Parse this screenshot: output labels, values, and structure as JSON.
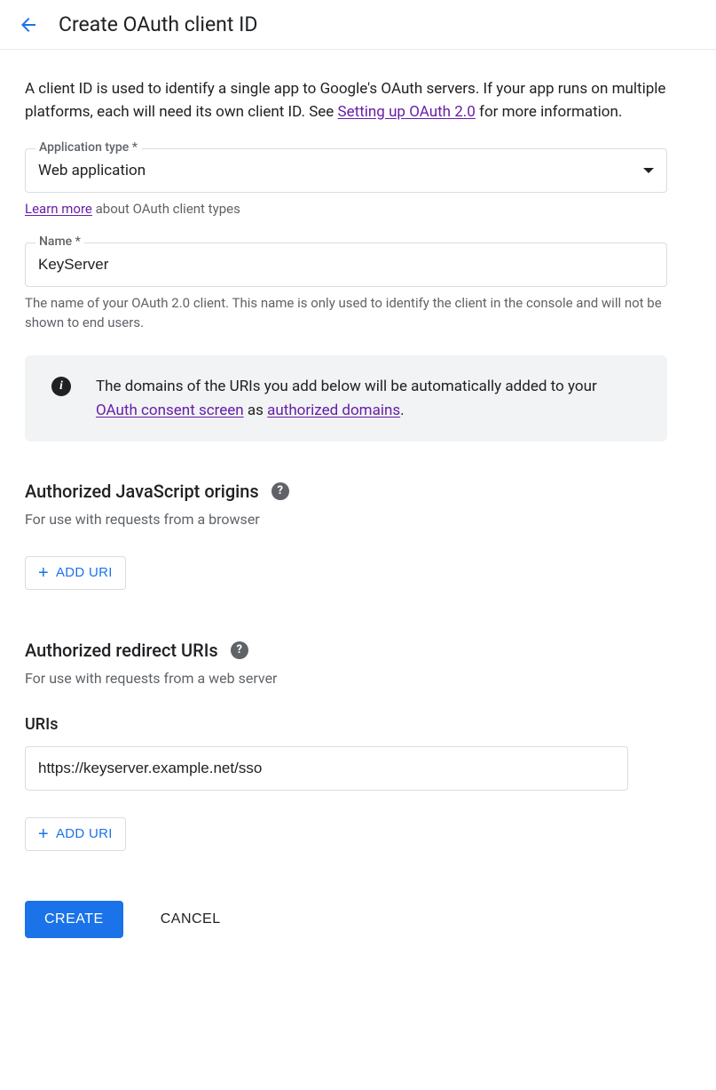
{
  "header": {
    "title": "Create OAuth client ID"
  },
  "intro": {
    "pre": "A client ID is used to identify a single app to Google's OAuth servers. If your app runs on multiple platforms, each will need its own client ID. See ",
    "link": "Setting up OAuth 2.0",
    "post": " for more information."
  },
  "app_type": {
    "label": "Application type *",
    "value": "Web application",
    "helper_link": "Learn more",
    "helper_text": " about OAuth client types"
  },
  "name_field": {
    "label": "Name *",
    "value": "KeyServer",
    "helper": "The name of your OAuth 2.0 client. This name is only used to identify the client in the console and will not be shown to end users."
  },
  "info_banner": {
    "pre": "The domains of the URIs you add below will be automatically added to your ",
    "link1": "OAuth consent screen",
    "mid": " as ",
    "link2": "authorized domains",
    "post": "."
  },
  "js_origins": {
    "title": "Authorized JavaScript origins",
    "sub": "For use with requests from a browser",
    "add_label": "ADD URI"
  },
  "redirect_uris": {
    "title": "Authorized redirect URIs",
    "sub": "For use with requests from a web server",
    "list_label": "URIs",
    "items": [
      "https://keyserver.example.net/sso"
    ],
    "add_label": "ADD URI"
  },
  "actions": {
    "create": "CREATE",
    "cancel": "CANCEL"
  }
}
